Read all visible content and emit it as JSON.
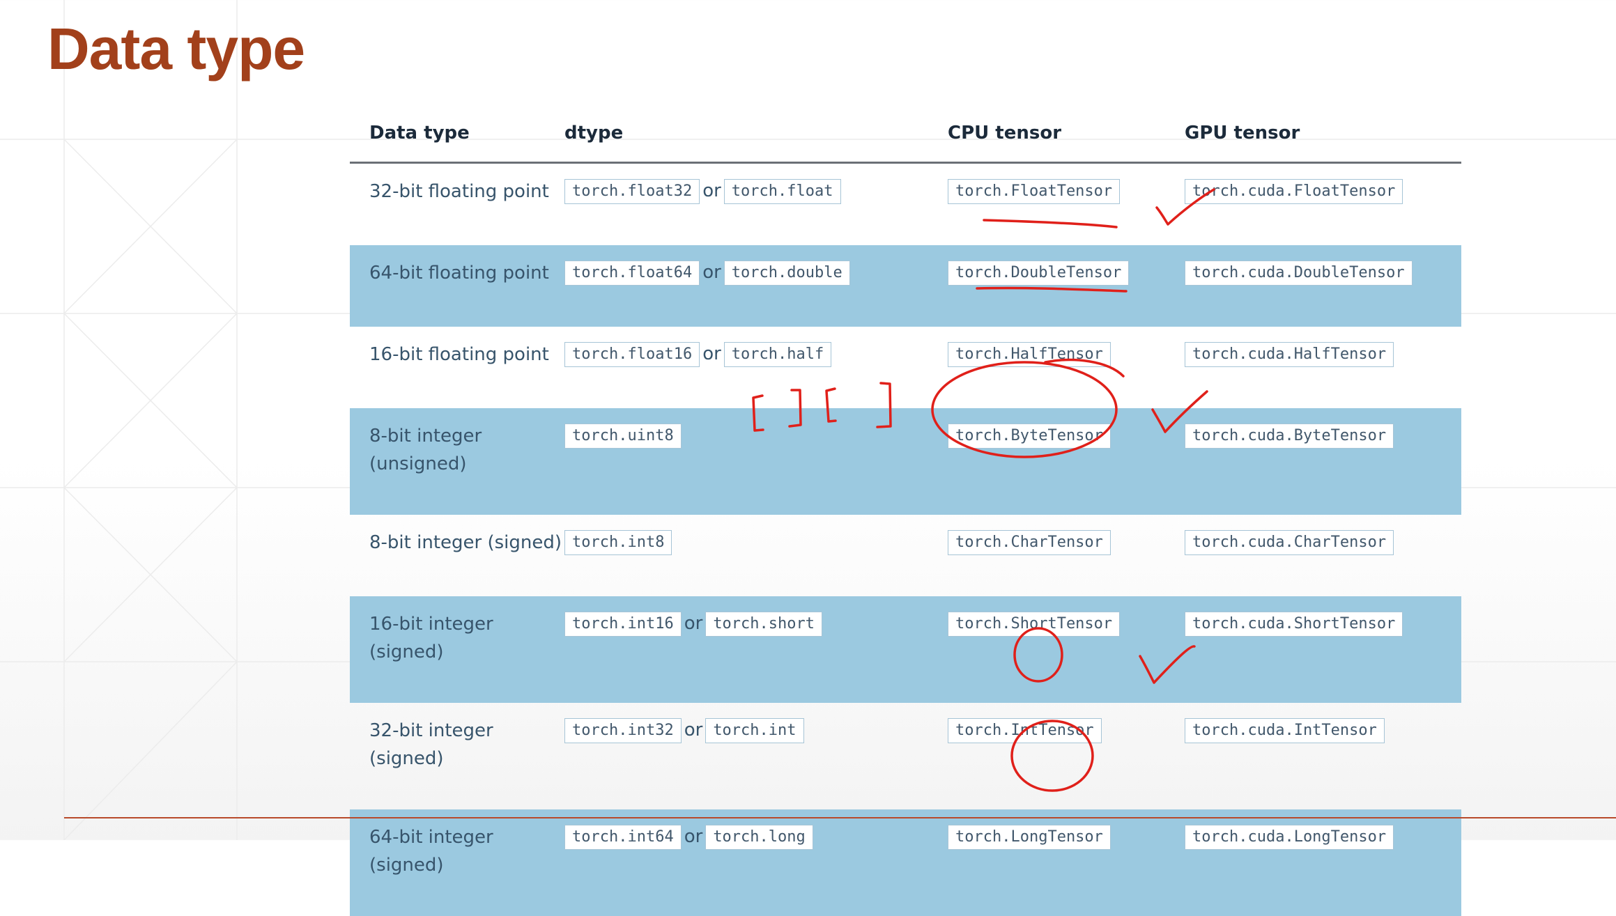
{
  "slide": {
    "title": "Data type"
  },
  "table": {
    "headers": [
      "Data type",
      "dtype",
      "CPU tensor",
      "GPU tensor"
    ],
    "rows": [
      {
        "type": "32-bit floating point",
        "dtype_primary": "torch.float32",
        "dtype_alias": "torch.float",
        "cpu": "torch.FloatTensor",
        "gpu": "torch.cuda.FloatTensor"
      },
      {
        "type": "64-bit floating point",
        "dtype_primary": "torch.float64",
        "dtype_alias": "torch.double",
        "cpu": "torch.DoubleTensor",
        "gpu": "torch.cuda.DoubleTensor"
      },
      {
        "type": "16-bit floating point",
        "dtype_primary": "torch.float16",
        "dtype_alias": "torch.half",
        "cpu": "torch.HalfTensor",
        "gpu": "torch.cuda.HalfTensor"
      },
      {
        "type": "8-bit integer (unsigned)",
        "dtype_primary": "torch.uint8",
        "dtype_alias": "",
        "cpu": "torch.ByteTensor",
        "gpu": "torch.cuda.ByteTensor"
      },
      {
        "type": "8-bit integer (signed)",
        "dtype_primary": "torch.int8",
        "dtype_alias": "",
        "cpu": "torch.CharTensor",
        "gpu": "torch.cuda.CharTensor"
      },
      {
        "type": "16-bit integer (signed)",
        "dtype_primary": "torch.int16",
        "dtype_alias": "torch.short",
        "cpu": "torch.ShortTensor",
        "gpu": "torch.cuda.ShortTensor"
      },
      {
        "type": "32-bit integer (signed)",
        "dtype_primary": "torch.int32",
        "dtype_alias": "torch.int",
        "cpu": "torch.IntTensor",
        "gpu": "torch.cuda.IntTensor"
      },
      {
        "type": "64-bit integer (signed)",
        "dtype_primary": "torch.int64",
        "dtype_alias": "torch.long",
        "cpu": "torch.LongTensor",
        "gpu": "torch.cuda.LongTensor"
      }
    ],
    "or_word": "or"
  },
  "colors": {
    "title": "#a2401b",
    "stripe": "#9bc9e0",
    "annotation_ink": "#e0201a",
    "bottom_rule": "#b84a2a"
  }
}
